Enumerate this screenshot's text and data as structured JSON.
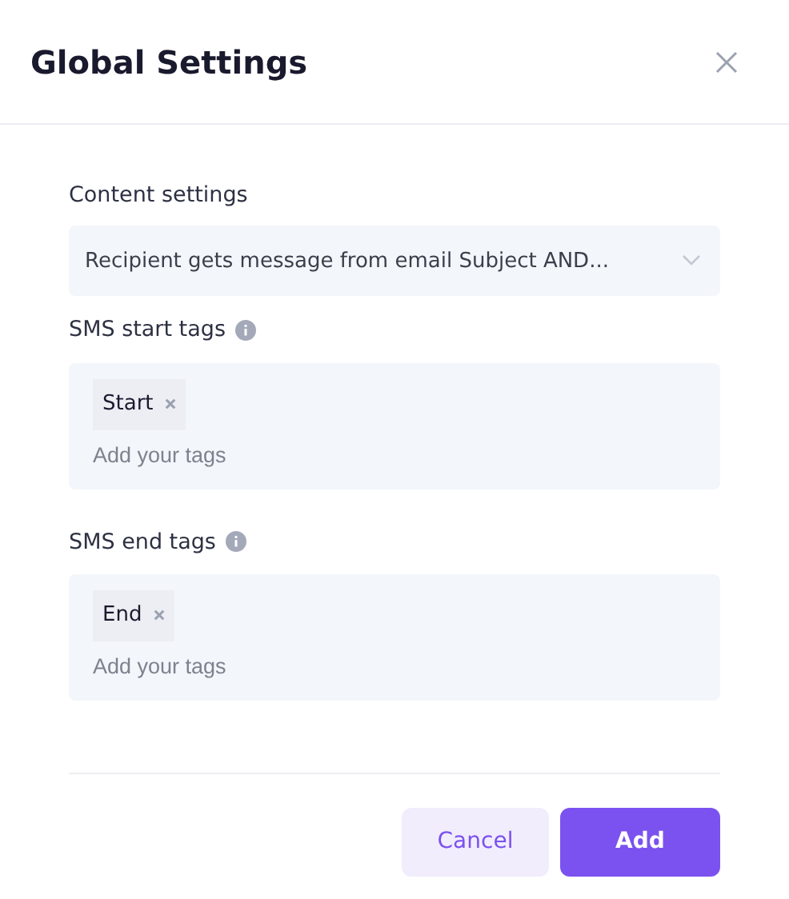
{
  "dialog": {
    "title": "Global Settings"
  },
  "content_settings": {
    "label": "Content settings",
    "value": "Recipient gets message from email Subject AND..."
  },
  "tag_fields": [
    {
      "label": "SMS start tags",
      "tags": [
        "Start"
      ],
      "placeholder": "Add your tags"
    },
    {
      "label": "SMS end tags",
      "tags": [
        "End"
      ],
      "placeholder": "Add your tags"
    }
  ],
  "buttons": [
    {
      "label": "Cancel",
      "kind": "secondary"
    },
    {
      "label": "Add",
      "kind": "primary"
    }
  ]
}
